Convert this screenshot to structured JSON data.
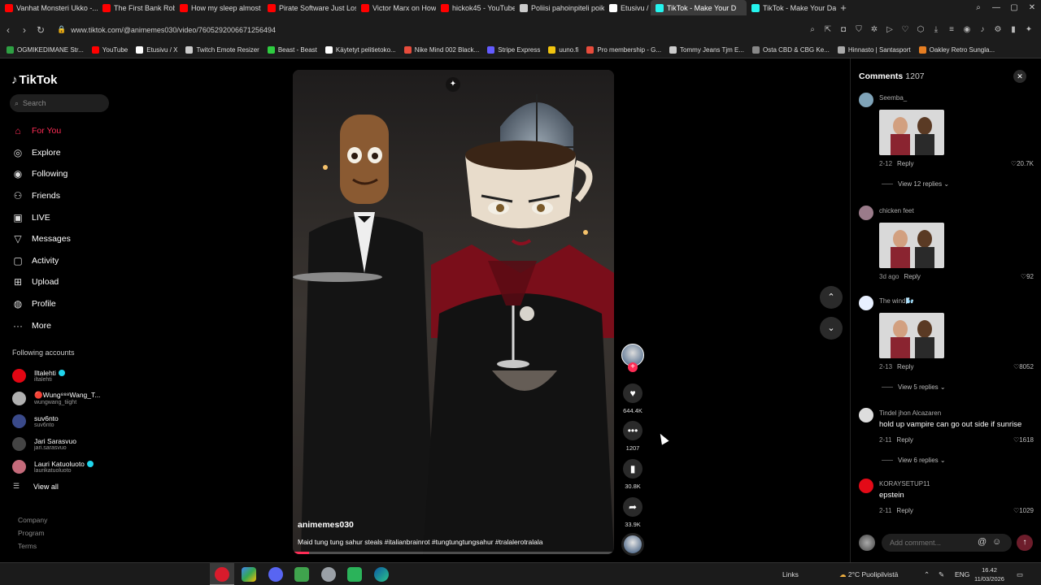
{
  "browser": {
    "tabs": [
      {
        "label": "Vanhat Monsteri Ukko -...",
        "color": "#ff0000"
      },
      {
        "label": "The First Bank Robber to",
        "color": "#ff0000"
      },
      {
        "label": "How my sleep almost Kil",
        "color": "#ff0000"
      },
      {
        "label": "Pirate Software Just Lost",
        "color": "#ff0000"
      },
      {
        "label": "Victor Marx on How Big",
        "color": "#ff0000"
      },
      {
        "label": "hickok45 - YouTube",
        "color": "#ff0000"
      },
      {
        "label": "Poliisi pahoinpiteli poikar",
        "color": "#cccccc"
      },
      {
        "label": "Etusivu / X",
        "color": "#ffffff"
      },
      {
        "label": "TikTok - Make Your D",
        "color": "#25f4ee",
        "active": true
      },
      {
        "label": "TikTok - Make Your Day",
        "color": "#25f4ee"
      }
    ],
    "url": "www.tiktok.com/@animemes030/video/7605292006671256494",
    "bookmarks": [
      {
        "label": "OGMIKEDIMANE Str...",
        "color": "#2ea043"
      },
      {
        "label": "YouTube",
        "color": "#ff0000"
      },
      {
        "label": "Etusivu / X",
        "color": "#ffffff"
      },
      {
        "label": "Twitch Emote Resizer",
        "color": "#cccccc"
      },
      {
        "label": "Beast - Beast",
        "color": "#2ecc40"
      },
      {
        "label": "Käytetyt pelitietoko...",
        "color": "#ffffff"
      },
      {
        "label": "Nike Mind 002 Black...",
        "color": "#e74c3c"
      },
      {
        "label": "Stripe Express",
        "color": "#635bff"
      },
      {
        "label": "uuno.fi",
        "color": "#f1c40f"
      },
      {
        "label": "Pro membership - G...",
        "color": "#e74c3c"
      },
      {
        "label": "Tommy Jeans Tjm E...",
        "color": "#cccccc"
      },
      {
        "label": "Osta CBD & CBG Ke...",
        "color": "#888888"
      },
      {
        "label": "Hinnasto | Santasport",
        "color": "#aaaaaa"
      },
      {
        "label": "Oakley Retro Sungla...",
        "color": "#e67e22"
      }
    ]
  },
  "sidebar": {
    "logo": "TikTok",
    "search_placeholder": "Search",
    "menu": [
      {
        "label": "For You",
        "icon": "home-icon",
        "glyph": "⌂",
        "active": true
      },
      {
        "label": "Explore",
        "icon": "compass-icon",
        "glyph": "◎"
      },
      {
        "label": "Following",
        "icon": "following-avatar-icon",
        "glyph": "◉"
      },
      {
        "label": "Friends",
        "icon": "friends-icon",
        "glyph": "⚇"
      },
      {
        "label": "LIVE",
        "icon": "live-icon",
        "glyph": "▣"
      },
      {
        "label": "Messages",
        "icon": "messages-icon",
        "glyph": "▽"
      },
      {
        "label": "Activity",
        "icon": "activity-icon",
        "glyph": "▢"
      },
      {
        "label": "Upload",
        "icon": "upload-icon",
        "glyph": "⊞"
      },
      {
        "label": "Profile",
        "icon": "profile-avatar-icon",
        "glyph": "◍"
      },
      {
        "label": "More",
        "icon": "more-icon",
        "glyph": "···"
      }
    ],
    "following_title": "Following accounts",
    "following": [
      {
        "name": "Iltalehti",
        "handle": "iltalehti",
        "verified": true,
        "color": "#e30613"
      },
      {
        "name": "🔴Wung⁸⁸⁸Wang_T...",
        "handle": "wungwang_tiight",
        "verified": false,
        "color": "#b0b0b0"
      },
      {
        "name": "suv6nto",
        "handle": "suv6nto",
        "verified": false,
        "color": "#3a4a8a"
      },
      {
        "name": "Jari Sarasvuo",
        "handle": "jari.sarasvuo",
        "verified": false,
        "color": "#444444"
      },
      {
        "name": "Lauri Katuoluoto",
        "handle": "laurikatuoluoto",
        "verified": true,
        "color": "#c46a7a"
      }
    ],
    "view_all": "View all",
    "footer": [
      "Company",
      "Program",
      "Terms"
    ]
  },
  "video": {
    "author": "animemes030",
    "caption": "Maid tung tung sahur steals #italianbrainrot #tungtungtungsahur #tralalerotralala",
    "progress": 0.05
  },
  "actions": {
    "likes": "644.4K",
    "comments": "1207",
    "saves": "30.8K",
    "shares": "33.9K"
  },
  "comments_panel": {
    "title": "Comments",
    "count": "1207",
    "items": [
      {
        "user": "Seemba_",
        "text": "",
        "has_image": true,
        "meta": "2-12",
        "reply": "Reply",
        "likes": "20.7K",
        "view_replies": "View 12 replies ⌄",
        "avatar_color": "#7fa3b8"
      },
      {
        "user": "chicken feet",
        "text": "",
        "has_image": true,
        "meta": "3d ago",
        "reply": "Reply",
        "likes": "92",
        "view_replies": "",
        "avatar_color": "#9a7b8a"
      },
      {
        "user": "The wind🌬️",
        "text": "",
        "has_image": true,
        "meta": "2-13",
        "reply": "Reply",
        "likes": "8052",
        "view_replies": "View 5 replies ⌄",
        "avatar_color": "#e8f0ff"
      },
      {
        "user": "Tindel jhon Alcazaren",
        "text": "hold up vampire can go out side if sunrise",
        "has_image": false,
        "meta": "2-11",
        "reply": "Reply",
        "likes": "1618",
        "view_replies": "View 6 replies ⌄",
        "avatar_color": "#dddddd"
      },
      {
        "user": "KORAYSETUP11",
        "text": "epstein",
        "has_image": false,
        "meta": "2-11",
        "reply": "Reply",
        "likes": "1029",
        "view_replies": "",
        "avatar_color": "#e30a17"
      }
    ],
    "add_placeholder": "Add comment..."
  },
  "taskbar": {
    "links_label": "Links",
    "weather": "2°C  Puolipilvistä",
    "lang": "ENG",
    "time": "16.42",
    "date": "11/03/2026"
  }
}
